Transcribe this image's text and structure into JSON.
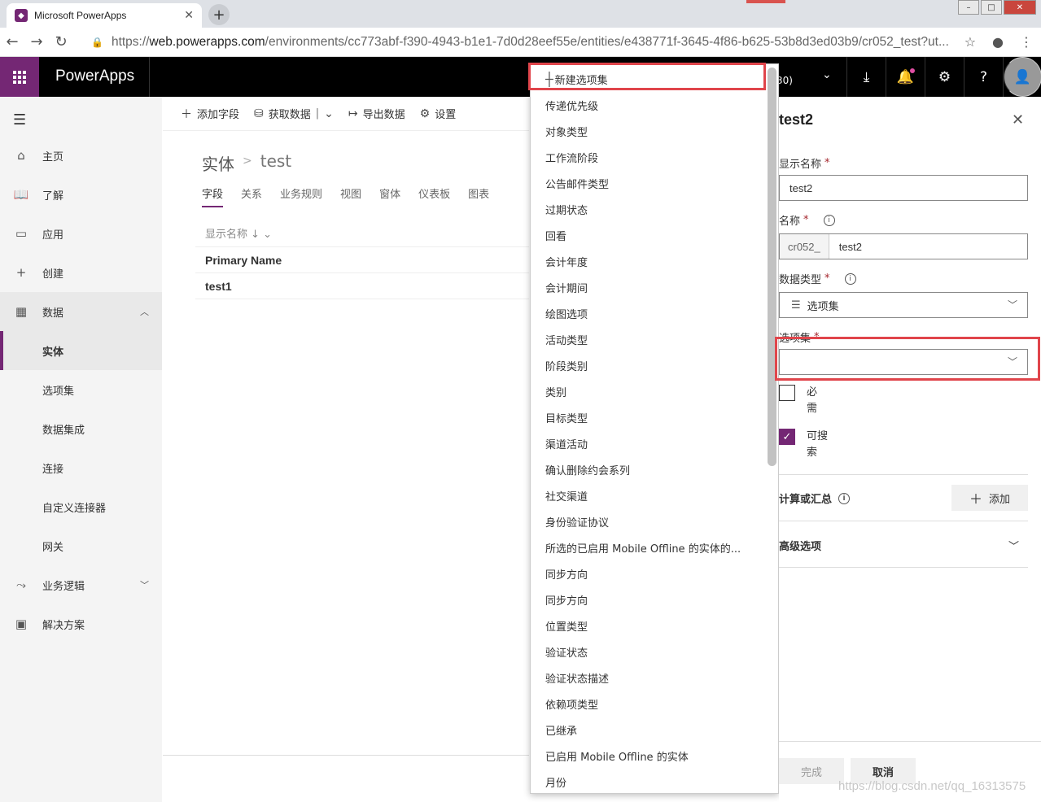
{
  "browser": {
    "tab_title": "Microsoft PowerApps",
    "url_scheme": "https://",
    "url_host": "web.powerapps.com",
    "url_path": "/environments/cc773abf-f390-4943-b1e1-7d0d28eef55e/entities/e438771f-3645-4f86-b625-53b8d3ed03b9/cr052_test?ut..."
  },
  "header": {
    "app_name": "PowerApps",
    "env_fragment": "30)"
  },
  "nav": {
    "items": [
      {
        "label": "主页",
        "icon": "home-icon"
      },
      {
        "label": "了解",
        "icon": "book-icon"
      },
      {
        "label": "应用",
        "icon": "apps-icon"
      },
      {
        "label": "创建",
        "icon": "plus-icon"
      },
      {
        "label": "数据",
        "icon": "table-icon"
      }
    ],
    "data_sub": [
      "实体",
      "选项集",
      "数据集成",
      "连接",
      "自定义连接器",
      "网关"
    ],
    "bottom": [
      {
        "label": "业务逻辑",
        "icon": "flow-icon"
      },
      {
        "label": "解决方案",
        "icon": "solution-icon"
      }
    ]
  },
  "commands": {
    "add_field": "添加字段",
    "get_data": "获取数据",
    "export_data": "导出数据",
    "settings": "设置"
  },
  "main": {
    "breadcrumb_root": "实体",
    "breadcrumb_current": "test",
    "tabs": [
      "字段",
      "关系",
      "业务规则",
      "视图",
      "窗体",
      "仪表板",
      "图表"
    ],
    "column_sort_label": "显示名称 ↓",
    "table_header": "Primary Name",
    "table_rows": [
      "test1"
    ]
  },
  "dropdown": {
    "new_label": "新建选项集",
    "items": [
      "传递优先级",
      "对象类型",
      "工作流阶段",
      "公告邮件类型",
      "过期状态",
      "回看",
      "会计年度",
      "会计期间",
      "绘图选项",
      "活动类型",
      "阶段类别",
      "类别",
      "目标类型",
      "渠道活动",
      "确认删除约会系列",
      "社交渠道",
      "身份验证协议",
      "所选的已启用 Mobile Offline 的实体的...",
      "同步方向",
      "同步方向",
      "位置类型",
      "验证状态",
      "验证状态描述",
      "依赖项类型",
      "已继承",
      "已启用 Mobile Offline 的实体",
      "月份"
    ]
  },
  "panel": {
    "title": "test2",
    "display_name_label": "显示名称",
    "display_name_value": "test2",
    "name_label": "名称",
    "name_prefix": "cr052_",
    "name_value": "test2",
    "data_type_label": "数据类型",
    "data_type_value": "选项集",
    "optionset_label": "选项集",
    "optionset_value": "",
    "required_label": "必需",
    "searchable_label": "可搜索",
    "calc_label": "计算或汇总",
    "add_label": "添加",
    "advanced_label": "高级选项",
    "done_label": "完成",
    "cancel_label": "取消",
    "required_mark": "*"
  },
  "watermark": "https://blog.csdn.net/qq_16313575",
  "colors": {
    "accent": "#742774",
    "highlight": "#e0454b"
  }
}
